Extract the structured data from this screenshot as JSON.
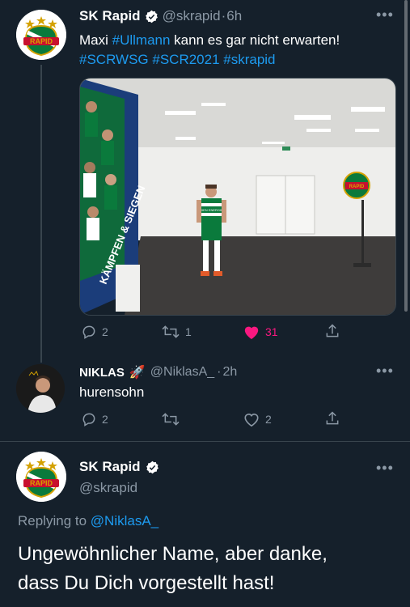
{
  "tweet1": {
    "name": "SK Rapid",
    "handle": "@skrapid",
    "sep": "·",
    "time": "6h",
    "text_pre": "Maxi ",
    "text_hashtag": "#Ullmann",
    "text_post": " kann es gar nicht erwarten!",
    "hashtags": "#SCRWSG #SCR2021 #skrapid",
    "image_banner_text": "KÄMPFEN & SIEGEN",
    "image_jersey_text": "WIEN ENERGIE",
    "image_logo_text": "RAPID",
    "replies": "2",
    "retweets": "1",
    "likes": "31",
    "like_color": "#f91880"
  },
  "tweet2": {
    "name": "NIKLAS",
    "emoji": "🚀",
    "handle": "@NiklasA_",
    "sep": "·",
    "time": "2h",
    "text": "hurensohn",
    "replies": "2",
    "likes": "2"
  },
  "tweet3": {
    "name": "SK Rapid",
    "handle": "@skrapid",
    "replying_label": "Replying to ",
    "replying_handle": "@NiklasA_",
    "text_line1": "Ungewöhnlicher Name, aber danke,",
    "text_line2": "dass Du Dich vorgestellt hast!"
  },
  "logo_text": "RAPID",
  "more_icon": "•••",
  "colors": {
    "accent": "#1d9bf0",
    "background": "#15202b",
    "rapid_green": "#0a7a3c"
  }
}
